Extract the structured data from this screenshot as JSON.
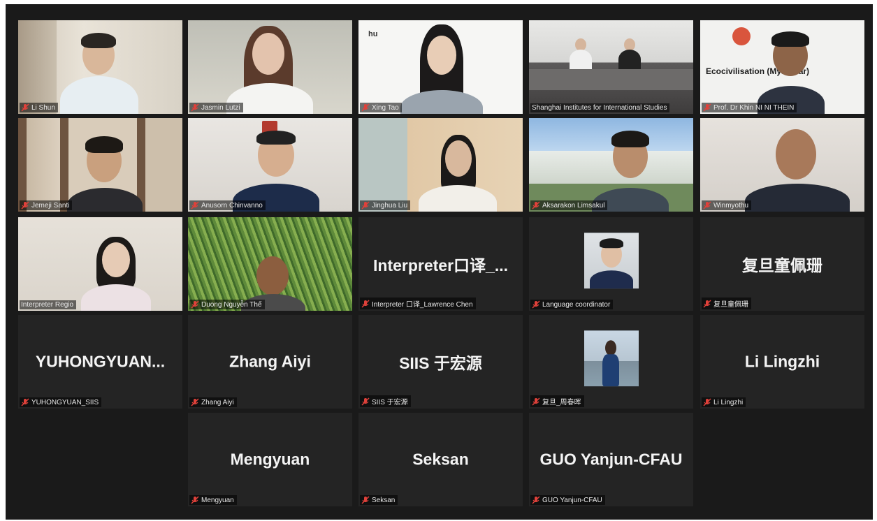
{
  "participants": [
    {
      "label": "Li Shun",
      "type": "video"
    },
    {
      "label": "Jasmin Lutzi",
      "type": "video"
    },
    {
      "label": "Xing Tao",
      "type": "video",
      "sign": "hu"
    },
    {
      "label": "Shanghai Institutes for International Studies",
      "type": "video"
    },
    {
      "label": "Prof. Dr Khin NI NI THEIN",
      "type": "video",
      "banner": "Ecocivilisation (Myanmar)"
    },
    {
      "label": "Jemeji Santi",
      "type": "video"
    },
    {
      "label": "Anusorn Chinvanno",
      "type": "video"
    },
    {
      "label": "Jinghua Liu",
      "type": "video"
    },
    {
      "label": "Aksarakon Limsakul",
      "type": "video"
    },
    {
      "label": "Winmyothu",
      "type": "video"
    },
    {
      "label": "Interpreter Regio",
      "type": "video"
    },
    {
      "label": "Duong Nguyễn Thế",
      "type": "video"
    },
    {
      "label": "Interpreter 口译_Lawrence Chen",
      "type": "name",
      "display": "Interpreter口译_..."
    },
    {
      "label": "Language coordinator",
      "type": "avatar"
    },
    {
      "label": "复旦童佩珊",
      "type": "name",
      "display": "复旦童佩珊"
    },
    {
      "label": "YUHONGYUAN_SIIS",
      "type": "name",
      "display": "YUHONGYUAN..."
    },
    {
      "label": "Zhang Aiyi",
      "type": "name",
      "display": "Zhang Aiyi"
    },
    {
      "label": "SIIS 于宏源",
      "type": "name",
      "display": "SIIS 于宏源"
    },
    {
      "label": "复旦_周春晖",
      "type": "avatar"
    },
    {
      "label": "Li Lingzhi",
      "type": "name",
      "display": "Li Lingzhi"
    },
    {
      "label": "Mengyuan",
      "type": "name",
      "display": "Mengyuan"
    },
    {
      "label": "Seksan",
      "type": "name",
      "display": "Seksan"
    },
    {
      "label": "GUO Yanjun-CFAU",
      "type": "name",
      "display": "GUO Yanjun-CFAU"
    }
  ],
  "colors": {
    "background": "#1a1a1a",
    "tile": "#242424",
    "active_speaker_border": "#e3d47a",
    "muted_mic": "#e0413a"
  }
}
